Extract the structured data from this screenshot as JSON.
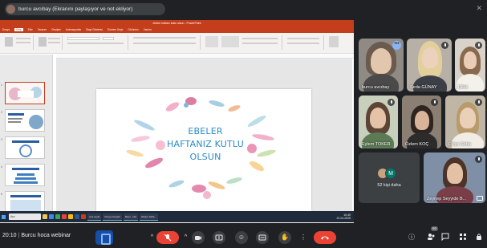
{
  "banner": {
    "text": "burcu avcıbay (Ekranını paylaşıyor ve not ekliyor)"
  },
  "ppt": {
    "title": "ebeler haftası kutlu olsun - PowerPoint",
    "tabs": [
      "Dosya",
      "Giriş",
      "Ekle",
      "Tasarım",
      "Geçişler",
      "Animasyonlar",
      "Slayt Gösterisi",
      "Gözden Geçir",
      "Görünüm",
      "Yardım"
    ],
    "active_tab": "Giriş",
    "slide_lines": [
      "EBELER",
      "HAFTANIZ KUTLU",
      "OLSUN"
    ],
    "notes_text": "Not eklemek için tıklatın",
    "thumb_numbers": [
      "1",
      "2",
      "3",
      "4",
      "5",
      "6"
    ],
    "taskbar_search": "Ara",
    "taskbar_apps": [
      "Ana sayfa",
      "Dosya Gezgini",
      "Meet - ebe",
      "Ebeler hafta..."
    ],
    "taskbar_time": "10:49",
    "taskbar_date": "22.04.2025"
  },
  "participants": [
    {
      "name": "burcu avcıbay",
      "color": "#9e9e9e"
    },
    {
      "name": "Seda GÜNAY",
      "color": "#b7b0a6"
    },
    {
      "name": "Dilek",
      "color": "#d9d2c8"
    },
    {
      "name": "Eylem TOKER",
      "color": "#c8d0bd"
    },
    {
      "name": "Özlem KOÇ",
      "color": "#8b7f74"
    },
    {
      "name": "Fulya Soba",
      "color": "#c0b6a6"
    },
    {
      "name": "Zeynep Seyyide B...",
      "color": "#7f8fa6"
    }
  ],
  "others": {
    "label": "52 kişi daha",
    "initial": "M"
  },
  "meeting": {
    "time": "20:10",
    "title": "Burcu hoca webinar",
    "participant_count": "60"
  },
  "icons": {
    "mic": "mic-off-icon",
    "camera": "camera-icon",
    "present": "present-icon",
    "emoji": "emoji-icon",
    "captions": "captions-icon",
    "hand": "hand-icon",
    "more": "more-vert-icon",
    "end": "call-end-icon",
    "info": "info-icon",
    "people": "people-icon",
    "chat": "chat-icon",
    "activities": "activities-icon"
  },
  "colors": {
    "end_call": "#ea4335",
    "accent": "#8ab4f8",
    "ppt": "#c43e1c",
    "slide_text": "#2a8bc6"
  }
}
